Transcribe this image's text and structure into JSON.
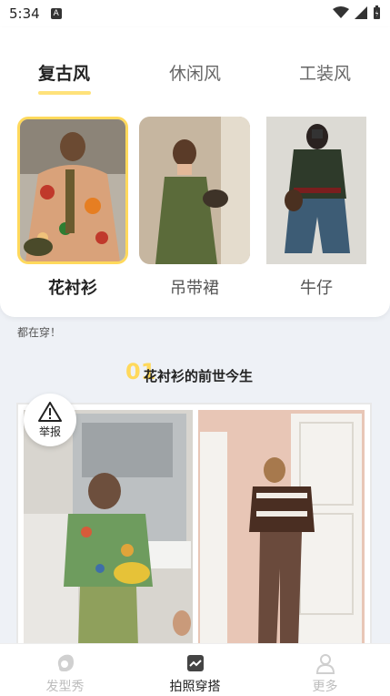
{
  "status_bar": {
    "time": "5:34",
    "badge": "A"
  },
  "tabs": [
    {
      "label": "复古风",
      "active": true
    },
    {
      "label": "休闲风",
      "active": false
    },
    {
      "label": "工装风",
      "active": false
    }
  ],
  "styles": [
    {
      "label": "花衬衫",
      "selected": true
    },
    {
      "label": "吊带裙",
      "selected": false
    },
    {
      "label": "牛仔",
      "selected": false
    }
  ],
  "intro_text": "都在穿！",
  "section": {
    "number": "01",
    "title": "花衬衫的前世今生"
  },
  "report": {
    "label": "举报"
  },
  "bottom_nav": [
    {
      "label": "发型秀",
      "icon": "hairstyle-icon",
      "active": false
    },
    {
      "label": "拍照穿搭",
      "icon": "photo-outfit-icon",
      "active": true
    },
    {
      "label": "更多",
      "icon": "more-user-icon",
      "active": false
    }
  ],
  "colors": {
    "accent": "#ffd95c",
    "background": "#eef1f6"
  }
}
